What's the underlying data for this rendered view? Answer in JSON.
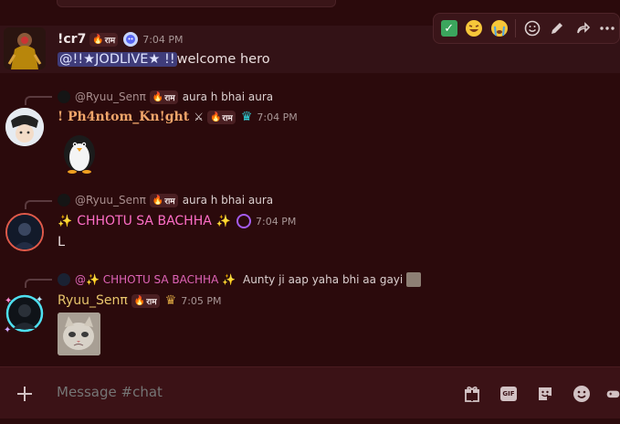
{
  "toolbar": {
    "reactions": [
      "✅",
      "🤣",
      "😭"
    ],
    "actions": [
      "add-reaction",
      "edit",
      "forward",
      "more"
    ]
  },
  "messages": [
    {
      "username": "!cr7",
      "username_color": "#f0e6e6",
      "tag_label": "राम",
      "timestamp": "7:04 PM",
      "content": "@!!★JODLIVE★ !!welcome  hero",
      "mention": "@!!★JODLIVE★ !!",
      "rest": "welcome  hero"
    },
    {
      "reply_name": "@Ryuu_Senπ",
      "reply_tag": "राम",
      "reply_text": "aura h bhai aura",
      "username": "! Ph4ntom_Kn!ght",
      "username_color": "#f0a56a",
      "tag_label": "राम",
      "timestamp": "7:04 PM"
    },
    {
      "reply_name": "@Ryuu_Senπ",
      "reply_tag": "राम",
      "reply_text": "aura h bhai aura",
      "username": "CHHOTU SA BACHHA",
      "username_color": "#ff6ec7",
      "timestamp": "7:04 PM",
      "content": "L"
    },
    {
      "reply_name": "@✨ CHHOTU SA BACHHA ✨",
      "reply_text": "Aunty ji aap yaha bhi aa gayi",
      "username": "Ryuu_Senπ",
      "username_color": "#e8c56c",
      "tag_label": "राम",
      "timestamp": "7:05 PM"
    }
  ],
  "composer": {
    "placeholder": "Message #chat",
    "gif_label": "GIF"
  }
}
